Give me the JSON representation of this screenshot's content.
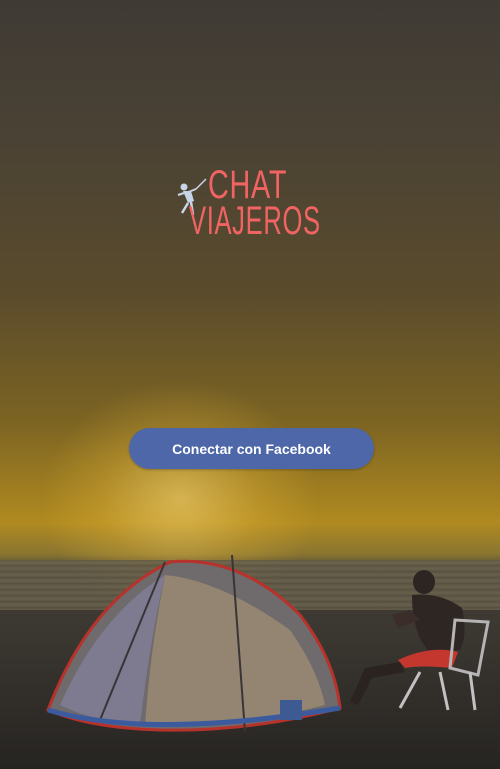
{
  "app": {
    "logo": {
      "line1": "CHAT",
      "line2": "VIAJEROS",
      "icon": "rappelling-climber-icon",
      "color": "#f26363"
    },
    "login_button": {
      "label": "Conectar con Facebook",
      "color": "#4e67a8"
    },
    "background": {
      "description_icon": "beach-camping-photo"
    }
  }
}
